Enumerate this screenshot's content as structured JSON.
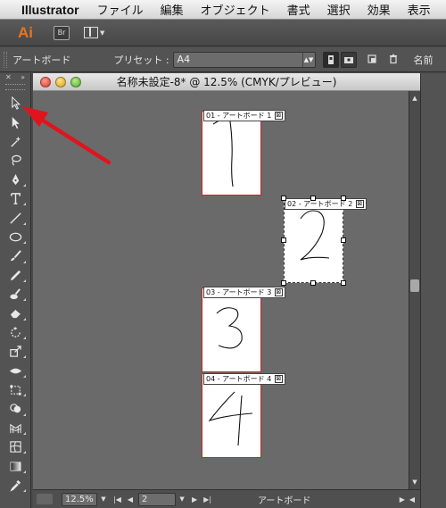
{
  "menubar": {
    "app_name": "Illustrator",
    "items": [
      "ファイル",
      "編集",
      "オブジェクト",
      "書式",
      "選択",
      "効果",
      "表示"
    ]
  },
  "appbar": {
    "app_logo": "Ai",
    "bridge_button": "Br"
  },
  "control_bar": {
    "mode_label": "アートボード",
    "preset_label": "プリセット :",
    "preset_value": "A4",
    "name_label": "名前"
  },
  "document": {
    "title": "名称未設定-8* @ 12.5% (CMYK/プレビュー)"
  },
  "artboards": [
    {
      "label": "01 - アートボード 1",
      "number": "1",
      "active": false
    },
    {
      "label": "02 - アートボード 2",
      "number": "2",
      "active": true
    },
    {
      "label": "03 - アートボード 3",
      "number": "3",
      "active": false
    },
    {
      "label": "04 - アートボード 4",
      "number": "4",
      "active": false
    }
  ],
  "status_bar": {
    "zoom": "12.5%",
    "page": "2",
    "status_text": "アートボード"
  },
  "annotation": {
    "arrow_color": "#e0141e"
  },
  "icons": {
    "tools": [
      "selection-tool",
      "direct-selection-tool",
      "magic-wand-tool",
      "lasso-tool",
      "pen-tool",
      "type-tool",
      "line-segment-tool",
      "ellipse-tool",
      "paintbrush-tool",
      "pencil-tool",
      "blob-brush-tool",
      "eraser-tool",
      "rotate-tool",
      "scale-tool",
      "width-tool",
      "free-transform-tool",
      "shape-builder-tool",
      "perspective-grid-tool",
      "mesh-tool",
      "gradient-tool",
      "eyedropper-tool"
    ]
  }
}
